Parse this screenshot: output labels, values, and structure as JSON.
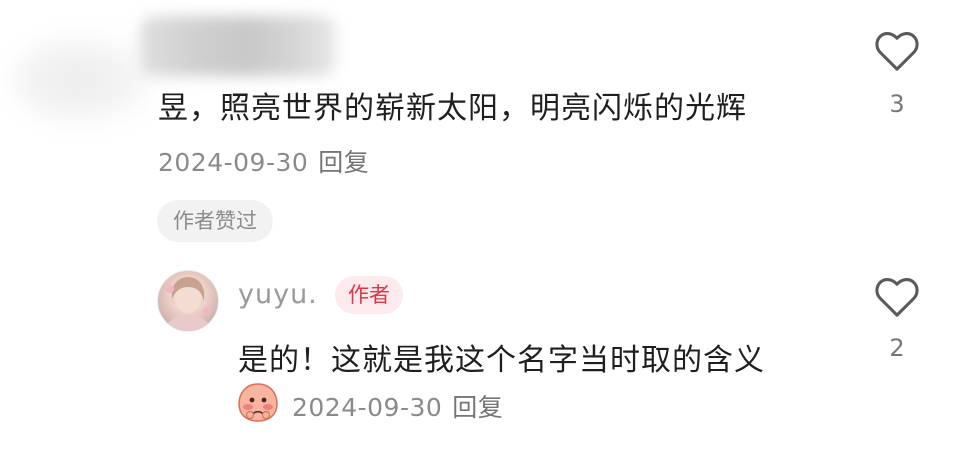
{
  "comment": {
    "text": "昱，照亮世界的崭新太阳，明亮闪烁的光辉",
    "date": "2024-09-30",
    "reply_label": "回复",
    "like_count": "3",
    "author_liked_label": "作者赞过"
  },
  "reply": {
    "username": "yuyu.",
    "author_badge": "作者",
    "text": "是的！这就是我这个名字当时取的含义",
    "date": "2024-09-30",
    "reply_label": "回复",
    "like_count": "2"
  },
  "icons": {
    "like": "heart-outline-icon",
    "emoji": "blushing-face-emoji"
  },
  "colors": {
    "badge_text": "#e3344a",
    "badge_bg": "#fdeaec",
    "meta_text": "#8a8a8a"
  }
}
